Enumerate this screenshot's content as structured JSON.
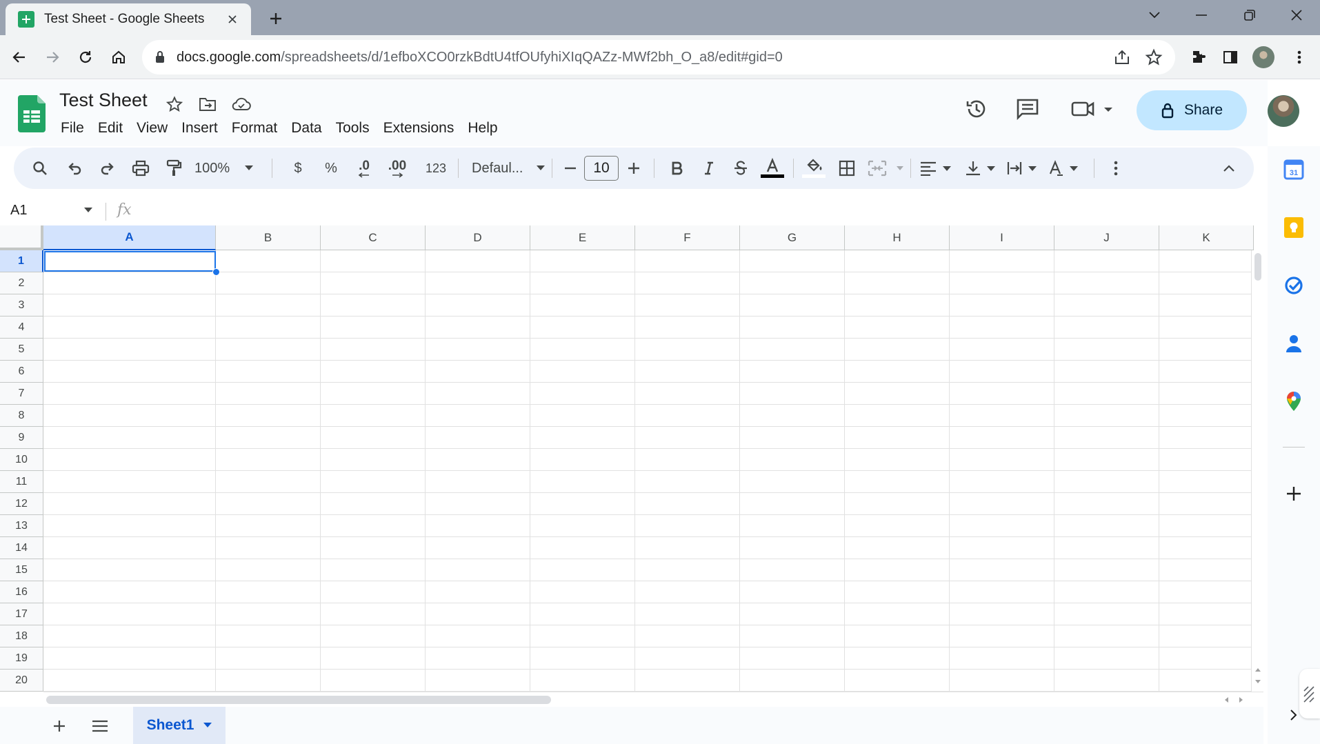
{
  "browser": {
    "tab_title": "Test Sheet - Google Sheets",
    "url_host": "docs.google.com",
    "url_path": "/spreadsheets/d/1efboXCO0rzkBdtU4tfOUfyhiXIqQAZz-MWf2bh_O_a8/edit#gid=0"
  },
  "doc": {
    "title": "Test Sheet",
    "menus": [
      "File",
      "Edit",
      "View",
      "Insert",
      "Format",
      "Data",
      "Tools",
      "Extensions",
      "Help"
    ],
    "share_label": "Share"
  },
  "toolbar": {
    "zoom": "100%",
    "currency": "$",
    "percent": "%",
    "decrease_decimal": ".0",
    "increase_decimal": ".00",
    "number_format": "123",
    "font": "Defaul...",
    "font_size": "10"
  },
  "formula_bar": {
    "name_box": "A1",
    "fx": "fx"
  },
  "grid": {
    "columns": [
      "A",
      "B",
      "C",
      "D",
      "E",
      "F",
      "G",
      "H",
      "I",
      "J",
      "K"
    ],
    "rows": [
      "1",
      "2",
      "3",
      "4",
      "5",
      "6",
      "7",
      "8",
      "9",
      "10",
      "11",
      "12",
      "13",
      "14",
      "15",
      "16",
      "17",
      "18",
      "19",
      "20"
    ],
    "selected_column": "A",
    "selected_row": "1"
  },
  "sheets": [
    {
      "name": "Sheet1",
      "active": true
    }
  ],
  "colors": {
    "accent": "#0b57d0",
    "share_bg": "#c2e7ff",
    "sheets_green": "#22a565"
  }
}
